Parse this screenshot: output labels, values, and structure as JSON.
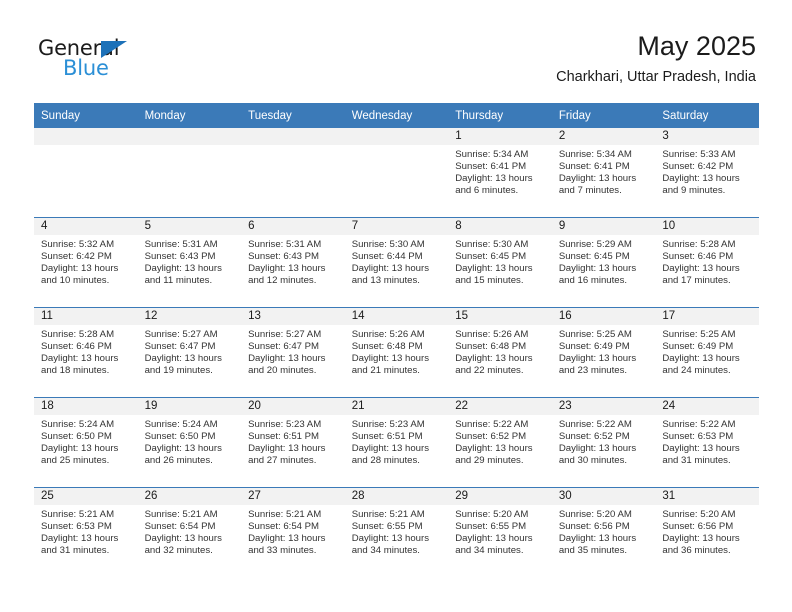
{
  "brand": {
    "name_part1": "General",
    "name_part2": "Blue",
    "triangle_icon": "triangle-icon"
  },
  "header": {
    "title": "May 2025",
    "subtitle": "Charkhari, Uttar Pradesh, India"
  },
  "colors": {
    "header_blue": "#3b7ab8",
    "brand_blue": "#2b8fd6",
    "logo_triangle_blue": "#1d71b8",
    "daynum_strip": "#f2f2f2",
    "text": "#1b1b1b"
  },
  "calendar": {
    "weekday_headers": [
      "Sunday",
      "Monday",
      "Tuesday",
      "Wednesday",
      "Thursday",
      "Friday",
      "Saturday"
    ],
    "weeks": [
      [
        {
          "day": "",
          "empty": true,
          "lines": []
        },
        {
          "day": "",
          "empty": true,
          "lines": []
        },
        {
          "day": "",
          "empty": true,
          "lines": []
        },
        {
          "day": "",
          "empty": true,
          "lines": []
        },
        {
          "day": "1",
          "empty": false,
          "lines": [
            "Sunrise: 5:34 AM",
            "Sunset: 6:41 PM",
            "Daylight: 13 hours",
            "and 6 minutes."
          ]
        },
        {
          "day": "2",
          "empty": false,
          "lines": [
            "Sunrise: 5:34 AM",
            "Sunset: 6:41 PM",
            "Daylight: 13 hours",
            "and 7 minutes."
          ]
        },
        {
          "day": "3",
          "empty": false,
          "lines": [
            "Sunrise: 5:33 AM",
            "Sunset: 6:42 PM",
            "Daylight: 13 hours",
            "and 9 minutes."
          ]
        }
      ],
      [
        {
          "day": "4",
          "empty": false,
          "lines": [
            "Sunrise: 5:32 AM",
            "Sunset: 6:42 PM",
            "Daylight: 13 hours",
            "and 10 minutes."
          ]
        },
        {
          "day": "5",
          "empty": false,
          "lines": [
            "Sunrise: 5:31 AM",
            "Sunset: 6:43 PM",
            "Daylight: 13 hours",
            "and 11 minutes."
          ]
        },
        {
          "day": "6",
          "empty": false,
          "lines": [
            "Sunrise: 5:31 AM",
            "Sunset: 6:43 PM",
            "Daylight: 13 hours",
            "and 12 minutes."
          ]
        },
        {
          "day": "7",
          "empty": false,
          "lines": [
            "Sunrise: 5:30 AM",
            "Sunset: 6:44 PM",
            "Daylight: 13 hours",
            "and 13 minutes."
          ]
        },
        {
          "day": "8",
          "empty": false,
          "lines": [
            "Sunrise: 5:30 AM",
            "Sunset: 6:45 PM",
            "Daylight: 13 hours",
            "and 15 minutes."
          ]
        },
        {
          "day": "9",
          "empty": false,
          "lines": [
            "Sunrise: 5:29 AM",
            "Sunset: 6:45 PM",
            "Daylight: 13 hours",
            "and 16 minutes."
          ]
        },
        {
          "day": "10",
          "empty": false,
          "lines": [
            "Sunrise: 5:28 AM",
            "Sunset: 6:46 PM",
            "Daylight: 13 hours",
            "and 17 minutes."
          ]
        }
      ],
      [
        {
          "day": "11",
          "empty": false,
          "lines": [
            "Sunrise: 5:28 AM",
            "Sunset: 6:46 PM",
            "Daylight: 13 hours",
            "and 18 minutes."
          ]
        },
        {
          "day": "12",
          "empty": false,
          "lines": [
            "Sunrise: 5:27 AM",
            "Sunset: 6:47 PM",
            "Daylight: 13 hours",
            "and 19 minutes."
          ]
        },
        {
          "day": "13",
          "empty": false,
          "lines": [
            "Sunrise: 5:27 AM",
            "Sunset: 6:47 PM",
            "Daylight: 13 hours",
            "and 20 minutes."
          ]
        },
        {
          "day": "14",
          "empty": false,
          "lines": [
            "Sunrise: 5:26 AM",
            "Sunset: 6:48 PM",
            "Daylight: 13 hours",
            "and 21 minutes."
          ]
        },
        {
          "day": "15",
          "empty": false,
          "lines": [
            "Sunrise: 5:26 AM",
            "Sunset: 6:48 PM",
            "Daylight: 13 hours",
            "and 22 minutes."
          ]
        },
        {
          "day": "16",
          "empty": false,
          "lines": [
            "Sunrise: 5:25 AM",
            "Sunset: 6:49 PM",
            "Daylight: 13 hours",
            "and 23 minutes."
          ]
        },
        {
          "day": "17",
          "empty": false,
          "lines": [
            "Sunrise: 5:25 AM",
            "Sunset: 6:49 PM",
            "Daylight: 13 hours",
            "and 24 minutes."
          ]
        }
      ],
      [
        {
          "day": "18",
          "empty": false,
          "lines": [
            "Sunrise: 5:24 AM",
            "Sunset: 6:50 PM",
            "Daylight: 13 hours",
            "and 25 minutes."
          ]
        },
        {
          "day": "19",
          "empty": false,
          "lines": [
            "Sunrise: 5:24 AM",
            "Sunset: 6:50 PM",
            "Daylight: 13 hours",
            "and 26 minutes."
          ]
        },
        {
          "day": "20",
          "empty": false,
          "lines": [
            "Sunrise: 5:23 AM",
            "Sunset: 6:51 PM",
            "Daylight: 13 hours",
            "and 27 minutes."
          ]
        },
        {
          "day": "21",
          "empty": false,
          "lines": [
            "Sunrise: 5:23 AM",
            "Sunset: 6:51 PM",
            "Daylight: 13 hours",
            "and 28 minutes."
          ]
        },
        {
          "day": "22",
          "empty": false,
          "lines": [
            "Sunrise: 5:22 AM",
            "Sunset: 6:52 PM",
            "Daylight: 13 hours",
            "and 29 minutes."
          ]
        },
        {
          "day": "23",
          "empty": false,
          "lines": [
            "Sunrise: 5:22 AM",
            "Sunset: 6:52 PM",
            "Daylight: 13 hours",
            "and 30 minutes."
          ]
        },
        {
          "day": "24",
          "empty": false,
          "lines": [
            "Sunrise: 5:22 AM",
            "Sunset: 6:53 PM",
            "Daylight: 13 hours",
            "and 31 minutes."
          ]
        }
      ],
      [
        {
          "day": "25",
          "empty": false,
          "lines": [
            "Sunrise: 5:21 AM",
            "Sunset: 6:53 PM",
            "Daylight: 13 hours",
            "and 31 minutes."
          ]
        },
        {
          "day": "26",
          "empty": false,
          "lines": [
            "Sunrise: 5:21 AM",
            "Sunset: 6:54 PM",
            "Daylight: 13 hours",
            "and 32 minutes."
          ]
        },
        {
          "day": "27",
          "empty": false,
          "lines": [
            "Sunrise: 5:21 AM",
            "Sunset: 6:54 PM",
            "Daylight: 13 hours",
            "and 33 minutes."
          ]
        },
        {
          "day": "28",
          "empty": false,
          "lines": [
            "Sunrise: 5:21 AM",
            "Sunset: 6:55 PM",
            "Daylight: 13 hours",
            "and 34 minutes."
          ]
        },
        {
          "day": "29",
          "empty": false,
          "lines": [
            "Sunrise: 5:20 AM",
            "Sunset: 6:55 PM",
            "Daylight: 13 hours",
            "and 34 minutes."
          ]
        },
        {
          "day": "30",
          "empty": false,
          "lines": [
            "Sunrise: 5:20 AM",
            "Sunset: 6:56 PM",
            "Daylight: 13 hours",
            "and 35 minutes."
          ]
        },
        {
          "day": "31",
          "empty": false,
          "lines": [
            "Sunrise: 5:20 AM",
            "Sunset: 6:56 PM",
            "Daylight: 13 hours",
            "and 36 minutes."
          ]
        }
      ]
    ]
  }
}
